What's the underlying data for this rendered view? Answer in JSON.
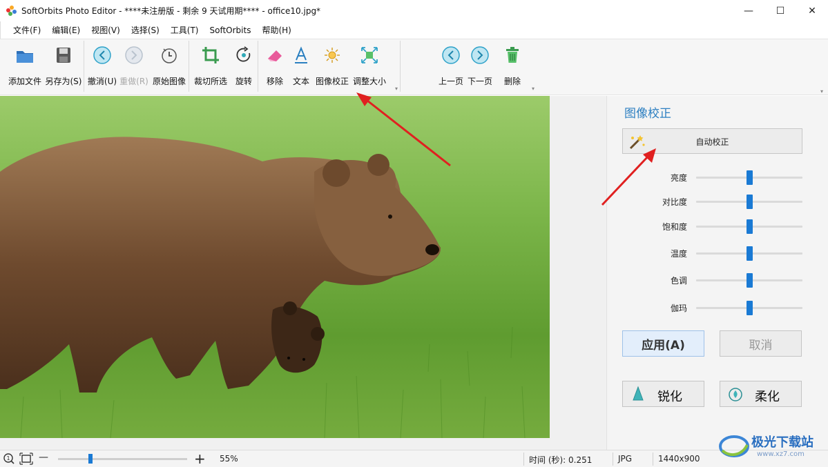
{
  "window": {
    "title": "SoftOrbits Photo Editor - ****未注册版 - 剩余 9 天试用期**** - office10.jpg*",
    "minimize": "—",
    "maximize": "☐",
    "close": "✕"
  },
  "menu": [
    "文件(F)",
    "编辑(E)",
    "视图(V)",
    "选择(S)",
    "工具(T)",
    "SoftOrbits",
    "帮助(H)"
  ],
  "toolbar": {
    "add_file": "添加文件",
    "save_as": "另存为(S)",
    "undo": "撤消(U)",
    "redo": "重做(R)",
    "original": "原始图像",
    "crop": "裁切所选",
    "rotate": "旋转",
    "remove": "移除",
    "text": "文本",
    "correction": "图像校正",
    "resize": "调整大小",
    "prev": "上一页",
    "next": "下一页",
    "delete": "删除"
  },
  "panel": {
    "title": "图像校正",
    "auto_correct": "自动校正",
    "sliders": [
      {
        "label": "亮度",
        "value": 0.5
      },
      {
        "label": "对比度",
        "value": 0.5
      },
      {
        "label": "饱和度",
        "value": 0.5
      },
      {
        "label": "温度",
        "value": 0.5
      },
      {
        "label": "色调",
        "value": 0.5
      },
      {
        "label": "伽玛",
        "value": 0.5
      }
    ],
    "apply": "应用(A)",
    "cancel": "取消",
    "sharpen": "锐化",
    "soften": "柔化"
  },
  "status": {
    "zoom_minus": "—",
    "zoom_plus": "+",
    "zoom_level": "55%",
    "zoom_value": 0.25,
    "time": "时间 (秒): 0.251",
    "format": "JPG",
    "size": "1440x900"
  },
  "watermark": {
    "text": "极光下载站",
    "url": "www.xz7.com"
  },
  "colors": {
    "accent": "#1a7ad4",
    "panel_title": "#2d7fc1",
    "arrow": "#e02020"
  }
}
